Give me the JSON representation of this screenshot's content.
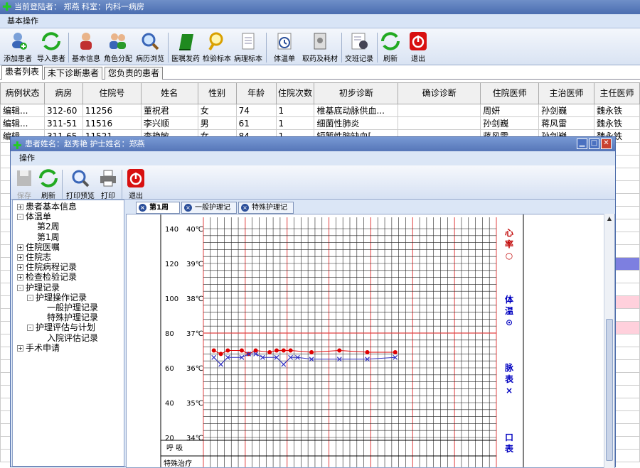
{
  "app": {
    "title": "当前登陆者：  郑燕   科室：内科一病房",
    "menu": "基本操作"
  },
  "toolbar": {
    "add": "添加患者",
    "import": "导入患者",
    "info": "基本信息",
    "role": "角色分配",
    "history": "病历浏览",
    "order": "医嘱发药",
    "inspect": "检验标本",
    "patho": "病理标本",
    "temp": "体温单",
    "drug": "取药及耗材",
    "shift": "交班记录",
    "refresh": "刷新",
    "exit": "退出"
  },
  "patient_tabs": [
    "患者列表",
    "未下诊断患者",
    "您负责的患者"
  ],
  "grid": {
    "headers": [
      "病例状态",
      "病房",
      "住院号",
      "姓名",
      "性别",
      "年龄",
      "住院次数",
      "初步诊断",
      "确诊诊断",
      "住院医师",
      "主治医师",
      "主任医师"
    ],
    "rows": [
      [
        "编辑...",
        "312-60",
        "11256",
        "董祝君",
        "女",
        "74",
        "1",
        "椎基底动脉供血...",
        "",
        "周妍",
        "孙剑巍",
        "魏永铁"
      ],
      [
        "编辑...",
        "311-51",
        "11516",
        "李兴顺",
        "男",
        "61",
        "1",
        "细菌性肺炎",
        "",
        "孙剑巍",
        "蒋风雷",
        "魏永铁"
      ],
      [
        "编辑...",
        "311-65",
        "11521",
        "李艳敏",
        "女",
        "84",
        "1",
        "短暂性脑缺血[...",
        "",
        "蒋风雷",
        "孙剑巍",
        "魏永铁"
      ]
    ],
    "right_col_repeat": "铁"
  },
  "dialog": {
    "title": "患者姓名：赵秀艳   护士姓名：郑燕",
    "menu": "操作",
    "save": "保存",
    "refresh": "刷新",
    "preview": "打印预览",
    "print": "打印",
    "exit": "退出",
    "tree": [
      {
        "label": "患者基本信息",
        "level": 0,
        "toggle": "+"
      },
      {
        "label": "体温单",
        "level": 0,
        "toggle": "-"
      },
      {
        "label": "第2周",
        "level": 2,
        "toggle": ""
      },
      {
        "label": "第1周",
        "level": 2,
        "toggle": ""
      },
      {
        "label": "住院医嘱",
        "level": 0,
        "toggle": "+"
      },
      {
        "label": "住院志",
        "level": 0,
        "toggle": "+"
      },
      {
        "label": "住院病程记录",
        "level": 0,
        "toggle": "+"
      },
      {
        "label": "检查检验记录",
        "level": 0,
        "toggle": "+"
      },
      {
        "label": "护理记录",
        "level": 0,
        "toggle": "-"
      },
      {
        "label": "护理操作记录",
        "level": 1,
        "toggle": "-"
      },
      {
        "label": "一般护理记录",
        "level": 3,
        "toggle": ""
      },
      {
        "label": "特殊护理记录",
        "level": 3,
        "toggle": ""
      },
      {
        "label": "护理评估与计划",
        "level": 1,
        "toggle": "-"
      },
      {
        "label": "入院评估记录",
        "level": 3,
        "toggle": ""
      },
      {
        "label": "手术申请",
        "level": 0,
        "toggle": "+"
      }
    ],
    "tabs": [
      "第1周",
      "一般护理记录",
      "特殊护理记录"
    ]
  },
  "chart_data": {
    "type": "line",
    "left_axis": [
      "140",
      "120",
      "100",
      "80",
      "60",
      "40",
      "20"
    ],
    "temp_axis": [
      "40℃",
      "39℃",
      "38℃",
      "37℃",
      "36℃",
      "35℃",
      "34℃"
    ],
    "bottom_rows": [
      "呼    吸",
      "特殊治疗"
    ],
    "legend": [
      {
        "label": "心率",
        "symbol": "○",
        "color": "#c00000"
      },
      {
        "label": "体温",
        "symbol": "⊙",
        "color": "#0000c0"
      },
      {
        "label": "脉表",
        "symbol": "×",
        "color": "#0000c0"
      },
      {
        "label": "口表",
        "symbol": "",
        "color": "#0000c0"
      }
    ],
    "series": [
      {
        "color": "#e00000",
        "values": [
          [
            0,
            70
          ],
          [
            1,
            68
          ],
          [
            2,
            70
          ],
          [
            4,
            70
          ],
          [
            5,
            68
          ],
          [
            6,
            70
          ],
          [
            8,
            69
          ],
          [
            9,
            70
          ],
          [
            10,
            70
          ],
          [
            11,
            70
          ],
          [
            14,
            69
          ],
          [
            18,
            70
          ],
          [
            22,
            69
          ],
          [
            26,
            69
          ]
        ]
      },
      {
        "color": "#3030c0",
        "values": [
          [
            0,
            66
          ],
          [
            1,
            62
          ],
          [
            2,
            66
          ],
          [
            4,
            66
          ],
          [
            5,
            68
          ],
          [
            6,
            68
          ],
          [
            7,
            66
          ],
          [
            9,
            66
          ],
          [
            10,
            62
          ],
          [
            11,
            66
          ],
          [
            12,
            66
          ],
          [
            14,
            65
          ],
          [
            18,
            65
          ],
          [
            22,
            65
          ],
          [
            26,
            66
          ]
        ]
      }
    ],
    "ylim": [
      20,
      140
    ]
  }
}
